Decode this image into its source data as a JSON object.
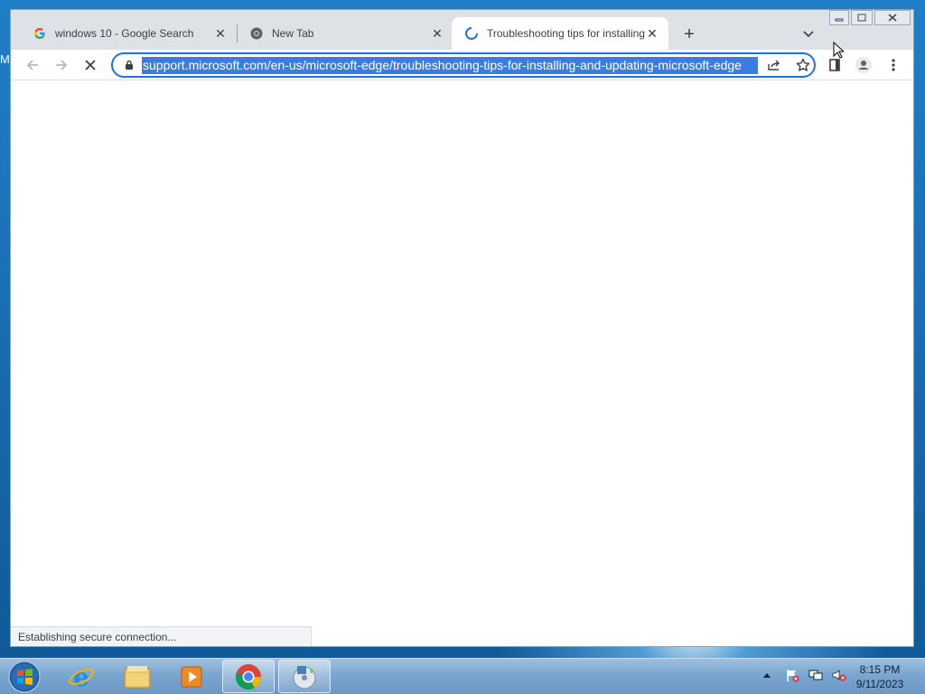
{
  "desktop": {
    "edge_letter": "M"
  },
  "browser": {
    "tabs": [
      {
        "title": "windows 10 - Google Search",
        "icon": "google-g-icon",
        "active": false
      },
      {
        "title": "New Tab",
        "icon": "chrome-icon",
        "active": false
      },
      {
        "title": "Troubleshooting tips for installing and updating Microsoft Edge",
        "icon": "loading-spinner-icon",
        "active": true
      }
    ],
    "url": "support.microsoft.com/en-us/microsoft-edge/troubleshooting-tips-for-installing-and-updating-microsoft-edge",
    "status_text": "Establishing secure connection...",
    "accent": "#1a73e8"
  },
  "taskbar": {
    "items": [
      "start-button",
      "internet-explorer",
      "file-explorer",
      "media-player",
      "chrome",
      "setup-disc"
    ],
    "clock": {
      "time": "8:15 PM",
      "date": "9/11/2023"
    }
  }
}
